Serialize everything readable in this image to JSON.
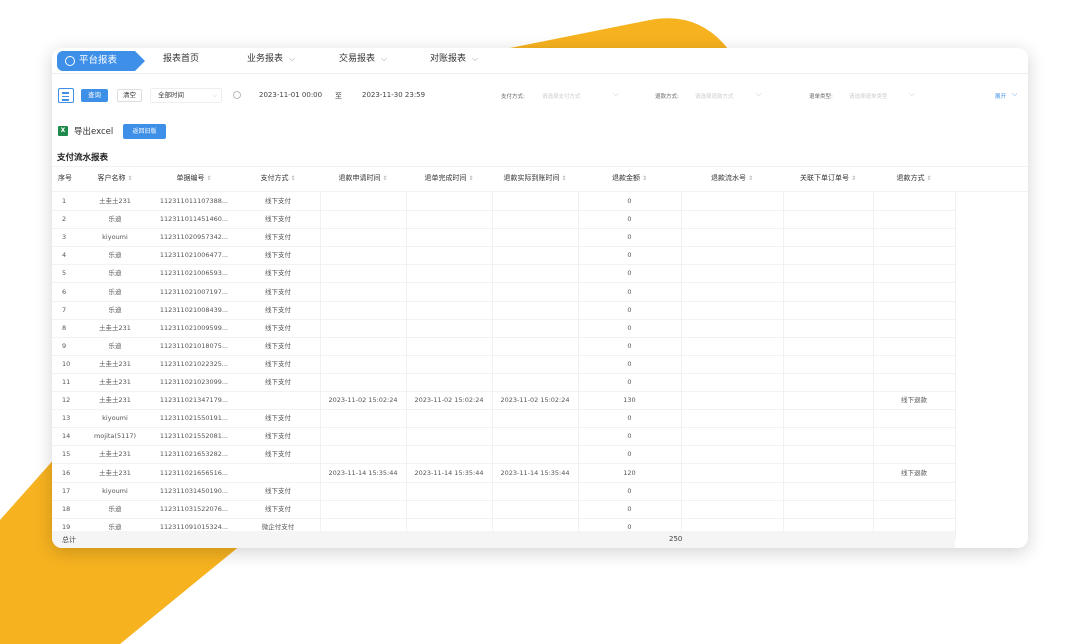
{
  "nav": {
    "brand": "平台报表",
    "items": [
      {
        "label": "报表首页",
        "caret": false
      },
      {
        "label": "业务报表",
        "caret": true
      },
      {
        "label": "交易报表",
        "caret": true
      },
      {
        "label": "对账报表",
        "caret": true
      }
    ]
  },
  "filters": {
    "query_btn": "查询",
    "clear_btn": "清空",
    "time_select": "全部时间",
    "start_time": "2023-11-01 00:00",
    "to_label": "至",
    "end_time": "2023-11-30 23:59",
    "pay_method_label": "支付方式:",
    "pay_method_placeholder": "请选择支付方式",
    "refund_method_label": "退款方式:",
    "refund_method_placeholder": "请选择退款方式",
    "doc_type_label": "退单类型:",
    "doc_type_placeholder": "请选择退单类型",
    "expand": "展开"
  },
  "toolbar": {
    "export_excel": "导出excel",
    "back_btn": "返回旧版"
  },
  "report": {
    "title": "支付流水报表",
    "columns": [
      "序号",
      "客户名称",
      "单据编号",
      "支付方式",
      "退款申请时间",
      "退单完成时间",
      "退款实际到账时间",
      "退款金额",
      "退款流水号",
      "关联下单订单号",
      "退款方式"
    ],
    "rows": [
      [
        "1",
        "土圭土231",
        "112311011107388...",
        "线下支付",
        "",
        "",
        "",
        "0",
        "",
        "",
        ""
      ],
      [
        "2",
        "乐迪",
        "112311011451460...",
        "线下支付",
        "",
        "",
        "",
        "0",
        "",
        "",
        ""
      ],
      [
        "3",
        "kiyoumi",
        "112311020957342...",
        "线下支付",
        "",
        "",
        "",
        "0",
        "",
        "",
        ""
      ],
      [
        "4",
        "乐迪",
        "112311021006477...",
        "线下支付",
        "",
        "",
        "",
        "0",
        "",
        "",
        ""
      ],
      [
        "5",
        "乐迪",
        "112311021006593...",
        "线下支付",
        "",
        "",
        "",
        "0",
        "",
        "",
        ""
      ],
      [
        "6",
        "乐迪",
        "112311021007197...",
        "线下支付",
        "",
        "",
        "",
        "0",
        "",
        "",
        ""
      ],
      [
        "7",
        "乐迪",
        "112311021008439...",
        "线下支付",
        "",
        "",
        "",
        "0",
        "",
        "",
        ""
      ],
      [
        "8",
        "土圭土231",
        "112311021009599...",
        "线下支付",
        "",
        "",
        "",
        "0",
        "",
        "",
        ""
      ],
      [
        "9",
        "乐迪",
        "112311021018075...",
        "线下支付",
        "",
        "",
        "",
        "0",
        "",
        "",
        ""
      ],
      [
        "10",
        "土圭土231",
        "112311021022325...",
        "线下支付",
        "",
        "",
        "",
        "0",
        "",
        "",
        ""
      ],
      [
        "11",
        "土圭土231",
        "112311021023099...",
        "线下支付",
        "",
        "",
        "",
        "0",
        "",
        "",
        ""
      ],
      [
        "12",
        "土圭土231",
        "112311021347179...",
        "",
        "2023-11-02 15:02:24",
        "2023-11-02 15:02:24",
        "2023-11-02 15:02:24",
        "130",
        "",
        "",
        "线下退款"
      ],
      [
        "13",
        "kiyoumi",
        "112311021550191...",
        "线下支付",
        "",
        "",
        "",
        "0",
        "",
        "",
        ""
      ],
      [
        "14",
        "mojita(5117)",
        "112311021552081...",
        "线下支付",
        "",
        "",
        "",
        "0",
        "",
        "",
        ""
      ],
      [
        "15",
        "土圭土231",
        "112311021653282...",
        "线下支付",
        "",
        "",
        "",
        "0",
        "",
        "",
        ""
      ],
      [
        "16",
        "土圭土231",
        "112311021656516...",
        "",
        "2023-11-14 15:35:44",
        "2023-11-14 15:35:44",
        "2023-11-14 15:35:44",
        "120",
        "",
        "",
        "线下退款"
      ],
      [
        "17",
        "kiyoumi",
        "112311031450190...",
        "线下支付",
        "",
        "",
        "",
        "0",
        "",
        "",
        ""
      ],
      [
        "18",
        "乐迪",
        "112311031522076...",
        "线下支付",
        "",
        "",
        "",
        "0",
        "",
        "",
        ""
      ],
      [
        "19",
        "乐迪",
        "112311091015324...",
        "微企付支付",
        "",
        "",
        "",
        "0",
        "",
        "",
        ""
      ]
    ],
    "total_label": "总计",
    "total_value": "250"
  },
  "colors": {
    "accent": "#3d8fe8",
    "stripe": "#f6b21f",
    "excel": "#1e8a4c"
  }
}
